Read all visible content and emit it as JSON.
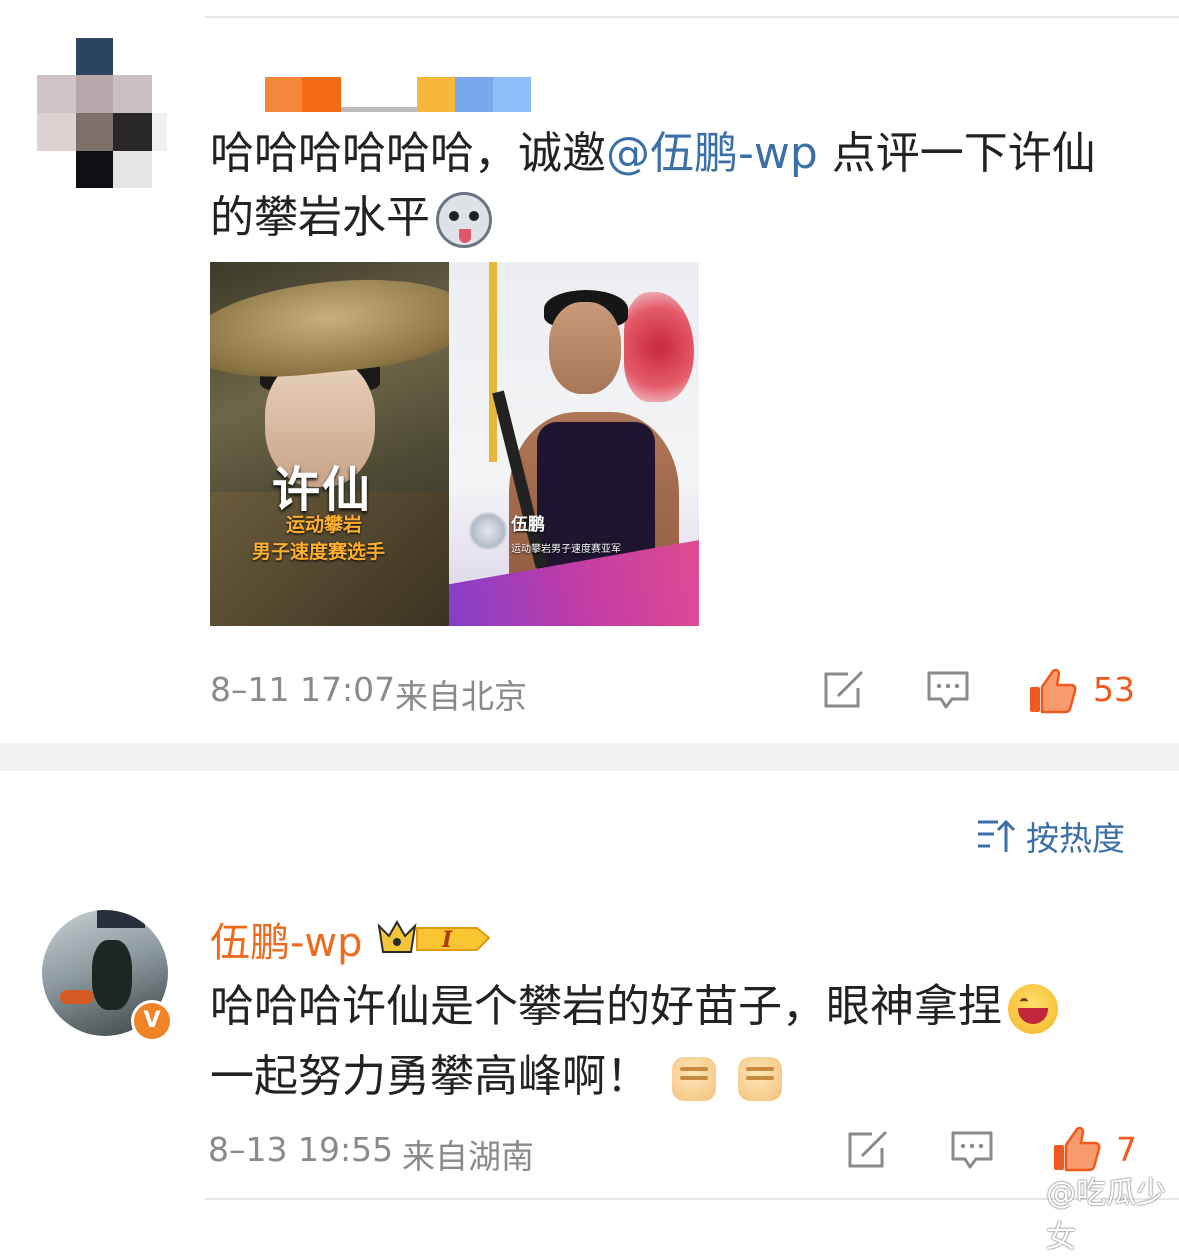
{
  "comment1": {
    "text_before": "哈哈哈哈哈哈，诚邀",
    "mention": "@伍鹏-wp",
    "text_after": " 点评一下许仙的攀岩水平",
    "emoji": "husky-emoji",
    "image_left": {
      "title": "许仙",
      "subtitle1": "运动攀岩",
      "subtitle2": "男子速度赛选手"
    },
    "image_right": {
      "name": "伍鹏",
      "subtitle": "运动攀岩男子速度赛亚军"
    },
    "timestamp": "8–11 17:07",
    "location": "来自北京",
    "like_count": "53",
    "colors": {
      "mention": "#3b6fa8",
      "like": "#f05a1e"
    }
  },
  "sort": {
    "label": "按热度"
  },
  "comment2": {
    "username": "伍鹏-wp",
    "level_badge": "I",
    "verified_badge": "V",
    "line1": "哈哈哈许仙是个攀岩的好苗子，眼神拿捏",
    "line2": "一起努力勇攀高峰啊！",
    "timestamp": "8–13 19:55",
    "location": "来自湖南",
    "like_count": "7",
    "colors": {
      "username": "#ec6b1e",
      "verified": "#f08326"
    }
  },
  "watermark": {
    "text": "@吃瓜少女"
  }
}
